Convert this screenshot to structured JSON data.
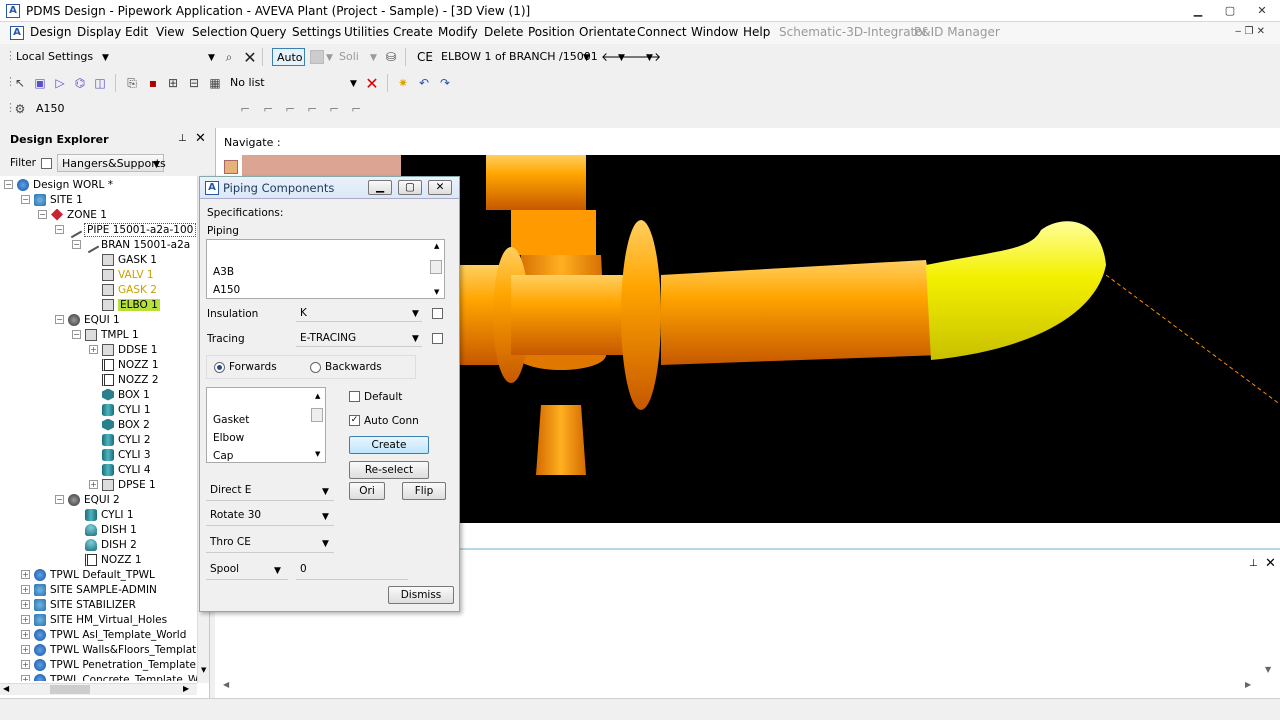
{
  "window": {
    "title": "PDMS Design - Pipework Application - AVEVA Plant (Project - Sample) - [3D View (1)]",
    "min": "▁",
    "max": "▢",
    "close": "✕"
  },
  "menubar": {
    "items": [
      "Design",
      "Display",
      "Edit",
      "View",
      "Selection",
      "Query",
      "Settings",
      "Utilities",
      "Create",
      "Modify",
      "Delete",
      "Position",
      "Orientate",
      "Connect",
      "Window",
      "Help"
    ],
    "dim_items": [
      "Schematic-3D-Integrator",
      "P&ID Manager"
    ]
  },
  "toolbar1": {
    "settings": "Local Settings",
    "auto": "Auto",
    "solid": "Soli",
    "ce_label": "CE",
    "ce_value": "ELBOW 1 of BRANCH /15001"
  },
  "toolbar2": {
    "list": "No list"
  },
  "toolbar3": {
    "spec": "A150"
  },
  "explorer": {
    "title": "Design Explorer",
    "filter_label": "Filter",
    "filter_value": "Hangers&Supports",
    "nodes": [
      {
        "label": "Design WORL *",
        "icon": "i-world",
        "level": 0,
        "exp": "−"
      },
      {
        "label": "SITE 1",
        "icon": "i-site",
        "level": 1,
        "exp": "−"
      },
      {
        "label": "ZONE 1",
        "icon": "i-zone",
        "level": 2,
        "exp": "−"
      },
      {
        "label": "PIPE 15001-a2a-100",
        "icon": "i-pipe",
        "level": 3,
        "exp": "−"
      },
      {
        "label": "BRAN 15001-a2a",
        "icon": "i-pipe",
        "level": 4,
        "exp": "−"
      },
      {
        "label": "GASK 1",
        "icon": "i-gen",
        "level": 5,
        "exp": ""
      },
      {
        "label": "VALV 1",
        "icon": "i-gen",
        "level": 5,
        "exp": ""
      },
      {
        "label": "GASK 2",
        "icon": "i-gen",
        "level": 5,
        "exp": ""
      },
      {
        "label": "ELBO 1",
        "icon": "i-gen",
        "level": 5,
        "exp": ""
      },
      {
        "label": "EQUI 1",
        "icon": "i-equi",
        "level": 3,
        "exp": "−"
      },
      {
        "label": "TMPL 1",
        "icon": "i-gen",
        "level": 4,
        "exp": "−"
      },
      {
        "label": "DDSE 1",
        "icon": "i-gen",
        "level": 5,
        "exp": "+"
      },
      {
        "label": "NOZZ 1",
        "icon": "i-nozz",
        "level": 5,
        "exp": ""
      },
      {
        "label": "NOZZ 2",
        "icon": "i-nozz",
        "level": 5,
        "exp": ""
      },
      {
        "label": "BOX 1",
        "icon": "i-box",
        "level": 5,
        "exp": ""
      },
      {
        "label": "CYLI 1",
        "icon": "i-cyl",
        "level": 5,
        "exp": ""
      },
      {
        "label": "BOX 2",
        "icon": "i-box",
        "level": 5,
        "exp": ""
      },
      {
        "label": "CYLI 2",
        "icon": "i-cyl",
        "level": 5,
        "exp": ""
      },
      {
        "label": "CYLI 3",
        "icon": "i-cyl",
        "level": 5,
        "exp": ""
      },
      {
        "label": "CYLI 4",
        "icon": "i-cyl",
        "level": 5,
        "exp": ""
      },
      {
        "label": "DPSE 1",
        "icon": "i-gen",
        "level": 5,
        "exp": "+"
      },
      {
        "label": "EQUI 2",
        "icon": "i-equi",
        "level": 3,
        "exp": "−"
      },
      {
        "label": "CYLI 1",
        "icon": "i-cyl",
        "level": 4,
        "exp": ""
      },
      {
        "label": "DISH 1",
        "icon": "i-dish",
        "level": 4,
        "exp": ""
      },
      {
        "label": "DISH 2",
        "icon": "i-dish",
        "level": 4,
        "exp": ""
      },
      {
        "label": "NOZZ 1",
        "icon": "i-nozz",
        "level": 4,
        "exp": ""
      },
      {
        "label": "TPWL Default_TPWL",
        "icon": "i-world",
        "level": 1,
        "exp": "+"
      },
      {
        "label": "SITE SAMPLE-ADMIN",
        "icon": "i-site",
        "level": 1,
        "exp": "+"
      },
      {
        "label": "SITE STABILIZER",
        "icon": "i-site",
        "level": 1,
        "exp": "+"
      },
      {
        "label": "SITE HM_Virtual_Holes",
        "icon": "i-site",
        "level": 1,
        "exp": "+"
      },
      {
        "label": "TPWL Asl_Template_World",
        "icon": "i-world",
        "level": 1,
        "exp": "+"
      },
      {
        "label": "TPWL Walls&Floors_Templat",
        "icon": "i-world",
        "level": 1,
        "exp": "+"
      },
      {
        "label": "TPWL Penetration_Template",
        "icon": "i-world",
        "level": 1,
        "exp": "+"
      },
      {
        "label": "TPWL Concrete_Template_W",
        "icon": "i-world",
        "level": 1,
        "exp": "+"
      }
    ]
  },
  "viewport": {
    "navigate": "Navigate :"
  },
  "dialog": {
    "title": "Piping Components",
    "specifications": "Specifications:",
    "piping": "Piping",
    "piping_items": [
      "A3B",
      "A150"
    ],
    "insulation_label": "Insulation",
    "insulation_value": "K",
    "tracing_label": "Tracing",
    "tracing_value": "E-TRACING",
    "forwards": "Forwards",
    "backwards": "Backwards",
    "component_items": [
      "Gasket",
      "Elbow",
      "Cap"
    ],
    "default": "Default",
    "autoconn": "Auto Conn",
    "create": "Create",
    "reselect": "Re-select",
    "ori": "Ori",
    "flip": "Flip",
    "direct": "Direct E",
    "rotate": "Rotate 30",
    "thro": "Thro CE",
    "spool": "Spool",
    "spool_value": "0",
    "dismiss": "Dismiss"
  },
  "colors": {
    "orange": "#ff9a00",
    "yellow": "#f4f000",
    "selected": "#b7e03a"
  }
}
